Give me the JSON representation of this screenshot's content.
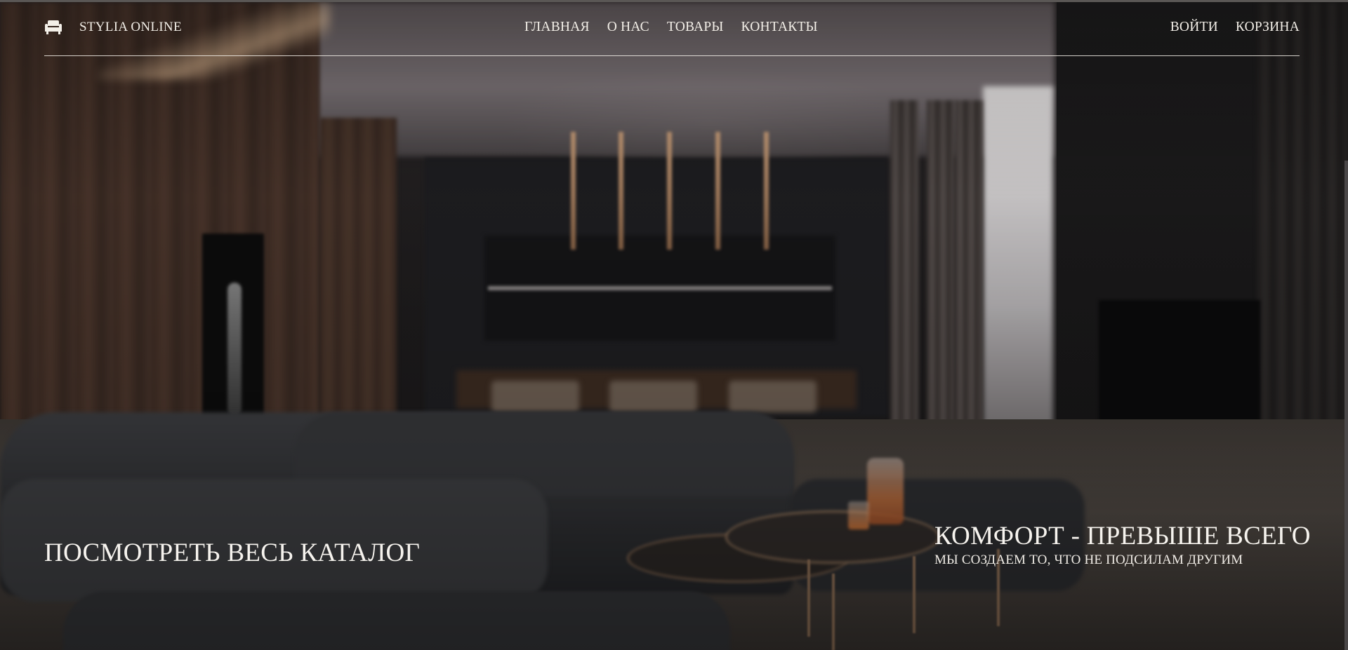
{
  "header": {
    "brand": {
      "icon": "armchair-icon",
      "name": "STYLIA ONLINE"
    },
    "nav": [
      {
        "label": "ГЛАВНАЯ"
      },
      {
        "label": "О НАС"
      },
      {
        "label": "ТОВАРЫ"
      },
      {
        "label": "КОНТАКТЫ"
      }
    ],
    "user_nav": {
      "login": "ВОЙТИ",
      "cart": "КОРЗИНА"
    }
  },
  "hero": {
    "catalog_link": "ПОСМОТРЕТЬ ВЕСЬ КАТАЛОГ",
    "slogan_title": "КОМФОРТ - ПРЕВЫШЕ ВСЕГО",
    "slogan_subtitle": "МЫ СОЗДАЕМ ТО, ЧТО НЕ ПОДСИЛАМ ДРУГИМ"
  },
  "colors": {
    "text": "#f3efe8",
    "background": "#151414",
    "divider": "#f3efe8"
  }
}
